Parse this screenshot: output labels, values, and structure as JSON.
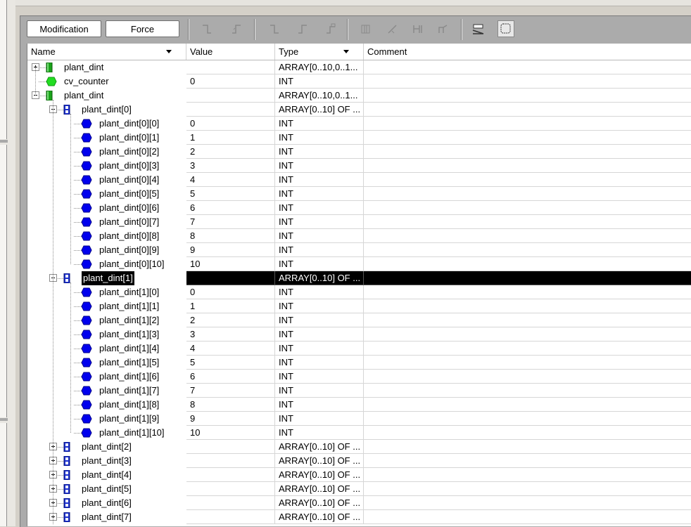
{
  "toolbar": {
    "modification_label": "Modification",
    "force_label": "Force"
  },
  "columns": {
    "name": "Name",
    "value": "Value",
    "type": "Type",
    "comment": "Comment"
  },
  "rows": [
    {
      "name": "plant_dint",
      "value": "",
      "type": "ARRAY[0..10,0..1...",
      "level": 0,
      "icon": "array-green",
      "expander": "plus"
    },
    {
      "name": "cv_counter",
      "value": "0",
      "type": "INT",
      "level": 0,
      "icon": "variable-green",
      "expander": "none"
    },
    {
      "name": "plant_dint",
      "value": "",
      "type": "ARRAY[0..10,0..1...",
      "level": 0,
      "icon": "array-green",
      "expander": "minus"
    },
    {
      "name": "plant_dint[0]",
      "value": "",
      "type": "ARRAY[0..10] OF ...",
      "level": 1,
      "icon": "array-blue",
      "expander": "minus"
    },
    {
      "name": "plant_dint[0][0]",
      "value": "0",
      "type": "INT",
      "level": 2,
      "icon": "element-blue",
      "expander": "none"
    },
    {
      "name": "plant_dint[0][1]",
      "value": "1",
      "type": "INT",
      "level": 2,
      "icon": "element-blue",
      "expander": "none"
    },
    {
      "name": "plant_dint[0][2]",
      "value": "2",
      "type": "INT",
      "level": 2,
      "icon": "element-blue",
      "expander": "none"
    },
    {
      "name": "plant_dint[0][3]",
      "value": "3",
      "type": "INT",
      "level": 2,
      "icon": "element-blue",
      "expander": "none"
    },
    {
      "name": "plant_dint[0][4]",
      "value": "4",
      "type": "INT",
      "level": 2,
      "icon": "element-blue",
      "expander": "none"
    },
    {
      "name": "plant_dint[0][5]",
      "value": "5",
      "type": "INT",
      "level": 2,
      "icon": "element-blue",
      "expander": "none"
    },
    {
      "name": "plant_dint[0][6]",
      "value": "6",
      "type": "INT",
      "level": 2,
      "icon": "element-blue",
      "expander": "none"
    },
    {
      "name": "plant_dint[0][7]",
      "value": "7",
      "type": "INT",
      "level": 2,
      "icon": "element-blue",
      "expander": "none"
    },
    {
      "name": "plant_dint[0][8]",
      "value": "8",
      "type": "INT",
      "level": 2,
      "icon": "element-blue",
      "expander": "none"
    },
    {
      "name": "plant_dint[0][9]",
      "value": "9",
      "type": "INT",
      "level": 2,
      "icon": "element-blue",
      "expander": "none"
    },
    {
      "name": "plant_dint[0][10]",
      "value": "10",
      "type": "INT",
      "level": 2,
      "icon": "element-blue",
      "expander": "none"
    },
    {
      "name": "plant_dint[1]",
      "value": "",
      "type": "ARRAY[0..10] OF ...",
      "level": 1,
      "icon": "array-blue",
      "expander": "minus",
      "selected": true
    },
    {
      "name": "plant_dint[1][0]",
      "value": "0",
      "type": "INT",
      "level": 2,
      "icon": "element-blue",
      "expander": "none"
    },
    {
      "name": "plant_dint[1][1]",
      "value": "1",
      "type": "INT",
      "level": 2,
      "icon": "element-blue",
      "expander": "none"
    },
    {
      "name": "plant_dint[1][2]",
      "value": "2",
      "type": "INT",
      "level": 2,
      "icon": "element-blue",
      "expander": "none"
    },
    {
      "name": "plant_dint[1][3]",
      "value": "3",
      "type": "INT",
      "level": 2,
      "icon": "element-blue",
      "expander": "none"
    },
    {
      "name": "plant_dint[1][4]",
      "value": "4",
      "type": "INT",
      "level": 2,
      "icon": "element-blue",
      "expander": "none"
    },
    {
      "name": "plant_dint[1][5]",
      "value": "5",
      "type": "INT",
      "level": 2,
      "icon": "element-blue",
      "expander": "none"
    },
    {
      "name": "plant_dint[1][6]",
      "value": "6",
      "type": "INT",
      "level": 2,
      "icon": "element-blue",
      "expander": "none"
    },
    {
      "name": "plant_dint[1][7]",
      "value": "7",
      "type": "INT",
      "level": 2,
      "icon": "element-blue",
      "expander": "none"
    },
    {
      "name": "plant_dint[1][8]",
      "value": "8",
      "type": "INT",
      "level": 2,
      "icon": "element-blue",
      "expander": "none"
    },
    {
      "name": "plant_dint[1][9]",
      "value": "9",
      "type": "INT",
      "level": 2,
      "icon": "element-blue",
      "expander": "none"
    },
    {
      "name": "plant_dint[1][10]",
      "value": "10",
      "type": "INT",
      "level": 2,
      "icon": "element-blue",
      "expander": "none"
    },
    {
      "name": "plant_dint[2]",
      "value": "",
      "type": "ARRAY[0..10] OF ...",
      "level": 1,
      "icon": "array-blue",
      "expander": "plus"
    },
    {
      "name": "plant_dint[3]",
      "value": "",
      "type": "ARRAY[0..10] OF ...",
      "level": 1,
      "icon": "array-blue",
      "expander": "plus"
    },
    {
      "name": "plant_dint[4]",
      "value": "",
      "type": "ARRAY[0..10] OF ...",
      "level": 1,
      "icon": "array-blue",
      "expander": "plus"
    },
    {
      "name": "plant_dint[5]",
      "value": "",
      "type": "ARRAY[0..10] OF ...",
      "level": 1,
      "icon": "array-blue",
      "expander": "plus"
    },
    {
      "name": "plant_dint[6]",
      "value": "",
      "type": "ARRAY[0..10] OF ...",
      "level": 1,
      "icon": "array-blue",
      "expander": "plus"
    },
    {
      "name": "plant_dint[7]",
      "value": "",
      "type": "ARRAY[0..10] OF ...",
      "level": 1,
      "icon": "array-blue",
      "expander": "plus"
    }
  ],
  "colors": {
    "panel_bg": "#ababab",
    "selection_bg": "#000000",
    "array_green": "#1aa31a",
    "element_blue": "#0000ee",
    "array_blue": "#1a2fd0"
  }
}
